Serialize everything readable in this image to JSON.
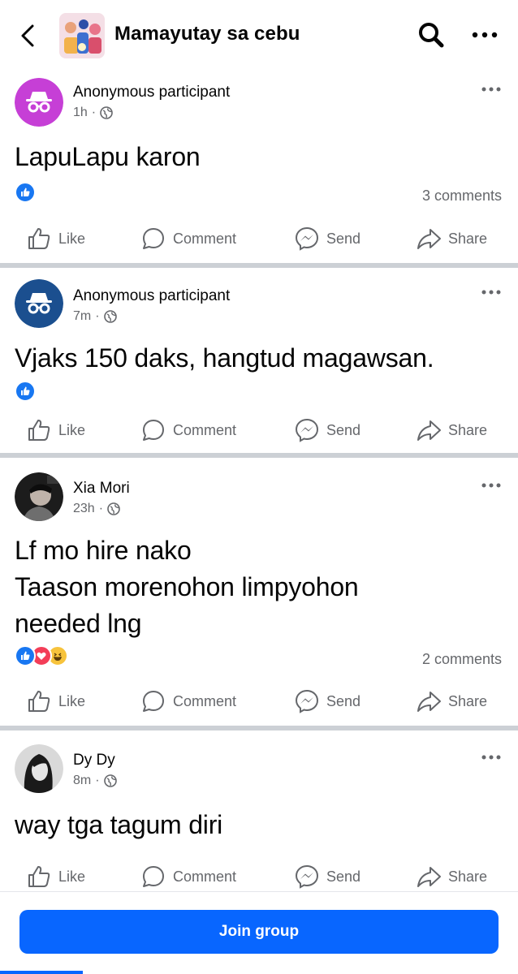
{
  "header": {
    "title": "Mamayutay sa cebu",
    "back_icon": "chevron-left-icon",
    "search_icon": "search-icon",
    "more_icon": "more-horizontal-icon"
  },
  "actions": {
    "like": "Like",
    "comment": "Comment",
    "send": "Send",
    "share": "Share"
  },
  "posts": [
    {
      "author": "Anonymous participant",
      "time": "1h",
      "avatar_color": "#c63fd6",
      "text": "LapuLapu karon",
      "reactions": [
        "like"
      ],
      "comments": "3 comments"
    },
    {
      "author": "Anonymous participant",
      "time": "7m",
      "avatar_color": "#1b4f8f",
      "text": "Vjaks 150 daks, hangtud magawsan.",
      "reactions": [
        "like"
      ],
      "comments": ""
    },
    {
      "author": "Xia Mori",
      "time": "23h",
      "text_lines": [
        "Lf mo hire nako",
        "Taason morenohon limpyohon",
        "needed lng"
      ],
      "reactions": [
        "like",
        "love",
        "haha"
      ],
      "comments": "2 comments"
    },
    {
      "author": "Dy Dy",
      "time": "8m",
      "text": "way tga tagum diri"
    }
  ],
  "join": {
    "label": "Join group"
  },
  "colors": {
    "brand_blue": "#0866ff",
    "secondary_text": "#65676b",
    "separator": "#ccd0d5"
  }
}
